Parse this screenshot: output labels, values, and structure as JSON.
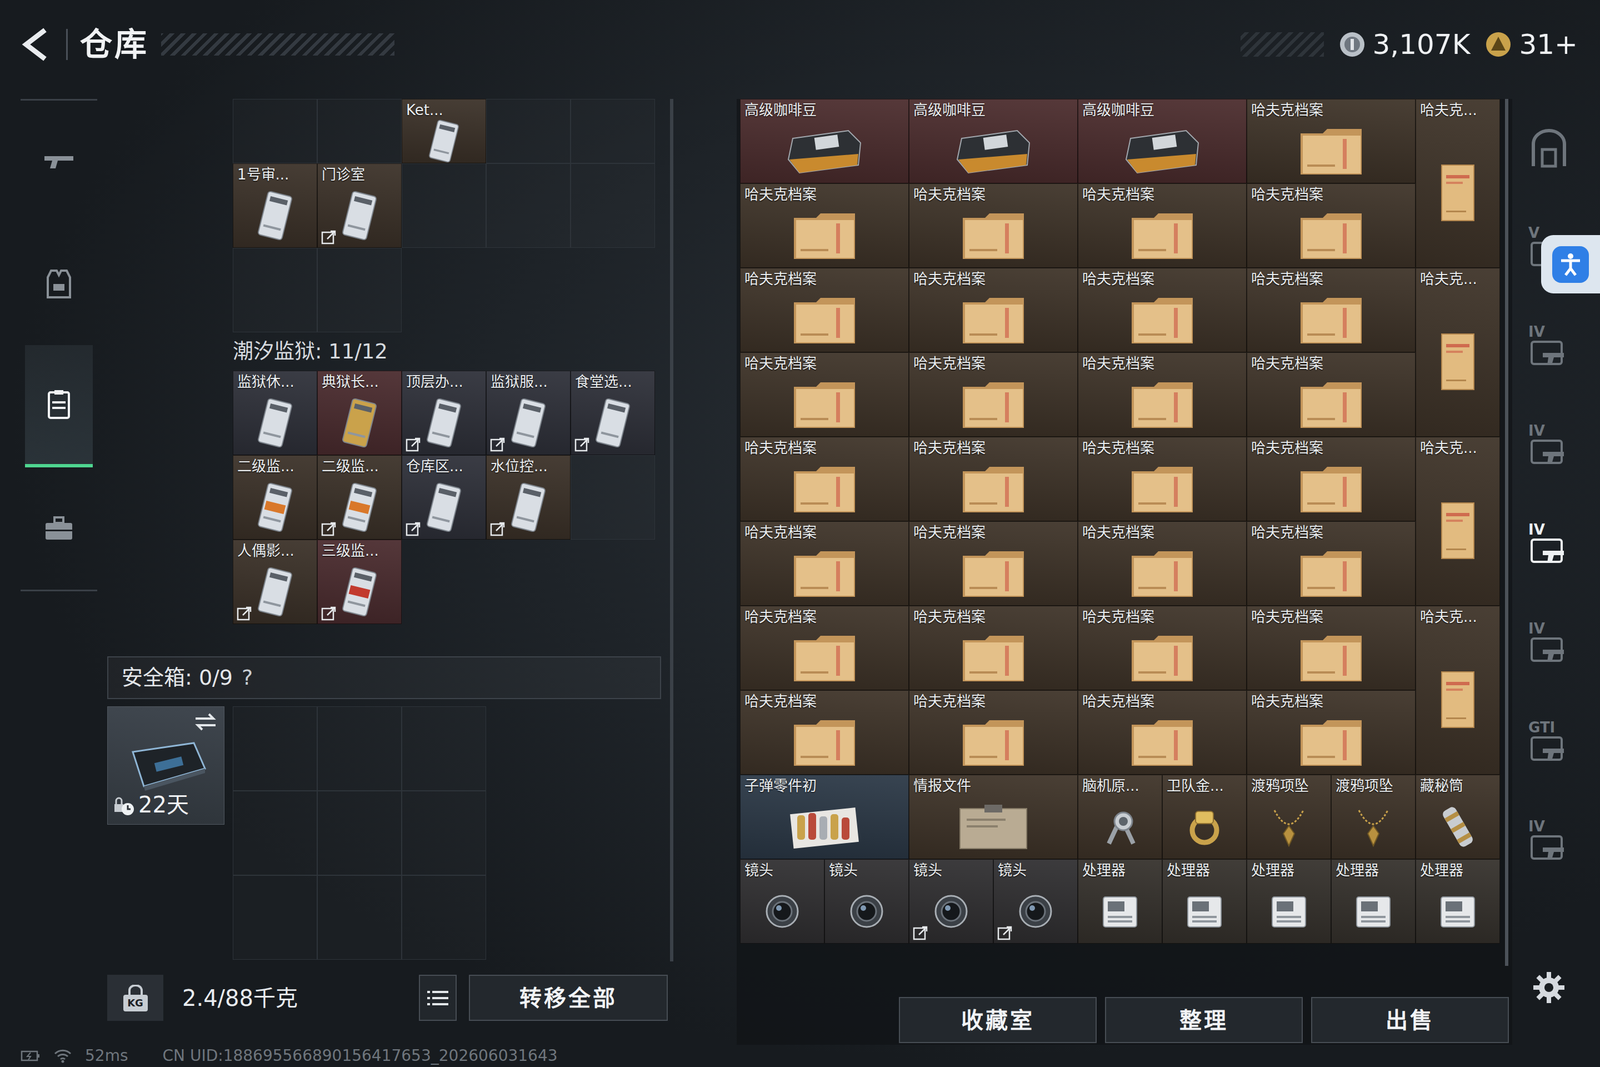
{
  "header": {
    "title": "仓库",
    "currencies": [
      {
        "kind": "coin",
        "amount": "3,107K"
      },
      {
        "kind": "ticket",
        "amount": "31+"
      }
    ]
  },
  "nav_rail": [
    {
      "kind": "gun",
      "selected": false
    },
    {
      "kind": "vest",
      "selected": false
    },
    {
      "kind": "case",
      "selected": true
    },
    {
      "kind": "toolbox",
      "selected": false
    }
  ],
  "keys_top": {
    "slots": [
      {
        "kind": "empty"
      },
      {
        "kind": "empty"
      },
      {
        "kind": "keycard",
        "label": "Ket...",
        "color": "#3b3128",
        "locked": false
      },
      {
        "kind": "empty"
      },
      {
        "kind": "empty"
      },
      {
        "kind": "keycard",
        "label": "1号审...",
        "color": "#3b3128",
        "locked": false
      },
      {
        "kind": "keycard",
        "label": "门诊室",
        "color": "#3b3128",
        "locked": true
      },
      {
        "kind": "empty"
      },
      {
        "kind": "empty"
      },
      {
        "kind": "empty"
      },
      {
        "kind": "empty"
      },
      {
        "kind": "empty"
      }
    ]
  },
  "tidal_prison": {
    "title": "潮汐监狱: 11/12",
    "slots": [
      {
        "kind": "keycard",
        "label": "监狱休...",
        "color": "#2e3039",
        "locked": false
      },
      {
        "kind": "goldcard",
        "label": "典狱长...",
        "color": "#4a2b2e",
        "locked": false
      },
      {
        "kind": "keycard",
        "label": "顶层办...",
        "color": "#2e3039",
        "locked": true
      },
      {
        "kind": "keycard",
        "label": "监狱服...",
        "color": "#2e3039",
        "locked": true
      },
      {
        "kind": "keycard",
        "label": "食堂选...",
        "color": "#2e3039",
        "locked": true
      },
      {
        "kind": "orangecard",
        "label": "二级监...",
        "color": "#3b3128",
        "locked": false
      },
      {
        "kind": "orangecard",
        "label": "二级监...",
        "color": "#3b3128",
        "locked": true
      },
      {
        "kind": "keycard",
        "label": "仓库区...",
        "color": "#2e3039",
        "locked": true
      },
      {
        "kind": "keycard",
        "label": "水位控...",
        "color": "#3b3128",
        "locked": true
      },
      {
        "kind": "empty"
      },
      {
        "kind": "keycard",
        "label": "人偶影...",
        "color": "#3b3128",
        "locked": true
      },
      {
        "kind": "redcard",
        "label": "三级监...",
        "color": "#4a2b2e",
        "locked": true
      }
    ]
  },
  "safe_box": {
    "title": "安全箱: 0/9",
    "help": "?",
    "timer": "22天",
    "locked": true,
    "empty_slots": 9
  },
  "load_bar": {
    "unit": "KG",
    "weight": "2.4/88千克",
    "transfer_button": "转移全部"
  },
  "warehouse": {
    "items": [
      {
        "kind": "coffee",
        "label": "高级咖啡豆",
        "color": "#4b2c2d",
        "locked": false
      },
      {
        "kind": "coffee",
        "label": "高级咖啡豆",
        "color": "#4b2c2d",
        "locked": false
      },
      {
        "kind": "coffee",
        "label": "高级咖啡豆",
        "color": "#4b2c2d",
        "locked": false
      },
      {
        "kind": "dossier",
        "label": "哈夫克档案",
        "color": "#3e3328",
        "locked": false
      },
      {
        "kind": "file",
        "label": "哈夫克...",
        "color": "#3e3328",
        "locked": false
      },
      {
        "kind": "dossier",
        "label": "哈夫克档案",
        "color": "#3e3328",
        "locked": false
      },
      {
        "kind": "dossier",
        "label": "哈夫克档案",
        "color": "#3e3328",
        "locked": false
      },
      {
        "kind": "dossier",
        "label": "哈夫克档案",
        "color": "#3e3328",
        "locked": false
      },
      {
        "kind": "dossier",
        "label": "哈夫克档案",
        "color": "#3e3328",
        "locked": false
      },
      {
        "kind": "dossier",
        "label": "哈夫克档案",
        "color": "#3e3328",
        "locked": false
      },
      {
        "kind": "dossier",
        "label": "哈夫克档案",
        "color": "#3e3328",
        "locked": false
      },
      {
        "kind": "dossier",
        "label": "哈夫克档案",
        "color": "#3e3328",
        "locked": false
      },
      {
        "kind": "dossier",
        "label": "哈夫克档案",
        "color": "#3e3328",
        "locked": false
      },
      {
        "kind": "file",
        "label": "哈夫克...",
        "color": "#3e3328",
        "locked": false
      },
      {
        "kind": "dossier",
        "label": "哈夫克档案",
        "color": "#3e3328",
        "locked": false
      },
      {
        "kind": "dossier",
        "label": "哈夫克档案",
        "color": "#3e3328",
        "locked": false
      },
      {
        "kind": "dossier",
        "label": "哈夫克档案",
        "color": "#3e3328",
        "locked": false
      },
      {
        "kind": "dossier",
        "label": "哈夫克档案",
        "color": "#3e3328",
        "locked": false
      },
      {
        "kind": "dossier",
        "label": "哈夫克档案",
        "color": "#3e3328",
        "locked": false
      },
      {
        "kind": "dossier",
        "label": "哈夫克档案",
        "color": "#3e3328",
        "locked": false
      },
      {
        "kind": "dossier",
        "label": "哈夫克档案",
        "color": "#3e3328",
        "locked": false
      },
      {
        "kind": "dossier",
        "label": "哈夫克档案",
        "color": "#3e3328",
        "locked": false
      },
      {
        "kind": "file",
        "label": "哈夫克...",
        "color": "#3e3328",
        "locked": false
      },
      {
        "kind": "dossier",
        "label": "哈夫克档案",
        "color": "#3e3328",
        "locked": false
      },
      {
        "kind": "dossier",
        "label": "哈夫克档案",
        "color": "#3e3328",
        "locked": false
      },
      {
        "kind": "dossier",
        "label": "哈夫克档案",
        "color": "#3e3328",
        "locked": false
      },
      {
        "kind": "dossier",
        "label": "哈夫克档案",
        "color": "#3e3328",
        "locked": false
      },
      {
        "kind": "dossier",
        "label": "哈夫克档案",
        "color": "#3e3328",
        "locked": false
      },
      {
        "kind": "dossier",
        "label": "哈夫克档案",
        "color": "#3e3328",
        "locked": false
      },
      {
        "kind": "dossier",
        "label": "哈夫克档案",
        "color": "#3e3328",
        "locked": false
      },
      {
        "kind": "dossier",
        "label": "哈夫克档案",
        "color": "#3e3328",
        "locked": false
      },
      {
        "kind": "file",
        "label": "哈夫克...",
        "color": "#3e3328",
        "locked": false
      },
      {
        "kind": "dossier",
        "label": "哈夫克档案",
        "color": "#3e3328",
        "locked": false
      },
      {
        "kind": "dossier",
        "label": "哈夫克档案",
        "color": "#3e3328",
        "locked": false
      },
      {
        "kind": "dossier",
        "label": "哈夫克档案",
        "color": "#3e3328",
        "locked": false
      },
      {
        "kind": "dossier",
        "label": "哈夫克档案",
        "color": "#3e3328",
        "locked": false
      },
      {
        "kind": "bullets",
        "label": "子弹零件初",
        "color": "#2b3846",
        "locked": false
      },
      {
        "kind": "intel",
        "label": "情报文件",
        "color": "#3e3328",
        "locked": false
      },
      {
        "kind": "watch",
        "label": "脑机原...",
        "color": "#3e3328",
        "locked": false
      },
      {
        "kind": "ring",
        "label": "卫队金...",
        "color": "#3e3328",
        "locked": false
      },
      {
        "kind": "pendant",
        "label": "渡鸦项坠",
        "color": "#3e3328",
        "locked": false
      },
      {
        "kind": "pendant",
        "label": "渡鸦项坠",
        "color": "#3e3328",
        "locked": false
      },
      {
        "kind": "capsule",
        "label": "藏秘筒",
        "color": "#3e3328",
        "locked": false
      },
      {
        "kind": "lens",
        "label": "镜头",
        "color": "#302f31",
        "locked": false
      },
      {
        "kind": "lens",
        "label": "镜头",
        "color": "#302f31",
        "locked": false
      },
      {
        "kind": "lens",
        "label": "镜头",
        "color": "#302f31",
        "locked": true
      },
      {
        "kind": "lens",
        "label": "镜头",
        "color": "#302f31",
        "locked": true
      },
      {
        "kind": "processor",
        "label": "处理器",
        "color": "#35312c",
        "locked": false
      },
      {
        "kind": "processor",
        "label": "处理器",
        "color": "#35312c",
        "locked": false
      },
      {
        "kind": "processor",
        "label": "处理器",
        "color": "#35312c",
        "locked": false
      },
      {
        "kind": "processor",
        "label": "处理器",
        "color": "#35312c",
        "locked": false
      },
      {
        "kind": "processor",
        "label": "处理器",
        "color": "#35312c",
        "locked": false
      }
    ]
  },
  "warehouse_buttons": [
    "收藏室",
    "整理",
    "出售"
  ],
  "side_tabs": [
    {
      "kind": "vault",
      "selected": false
    },
    {
      "kind": "tag",
      "label": "V",
      "selected": false
    },
    {
      "kind": "tag",
      "label": "IV",
      "selected": false
    },
    {
      "kind": "tag",
      "label": "IV",
      "selected": false
    },
    {
      "kind": "tag",
      "label": "IV",
      "selected": true
    },
    {
      "kind": "tag",
      "label": "IV",
      "selected": false
    },
    {
      "kind": "tag",
      "label": "GTI",
      "selected": false
    },
    {
      "kind": "tag",
      "label": "IV",
      "selected": false
    }
  ],
  "status_bar": {
    "ping": "52ms",
    "uid": "CN UID:188695566890156417653_202606031643"
  }
}
